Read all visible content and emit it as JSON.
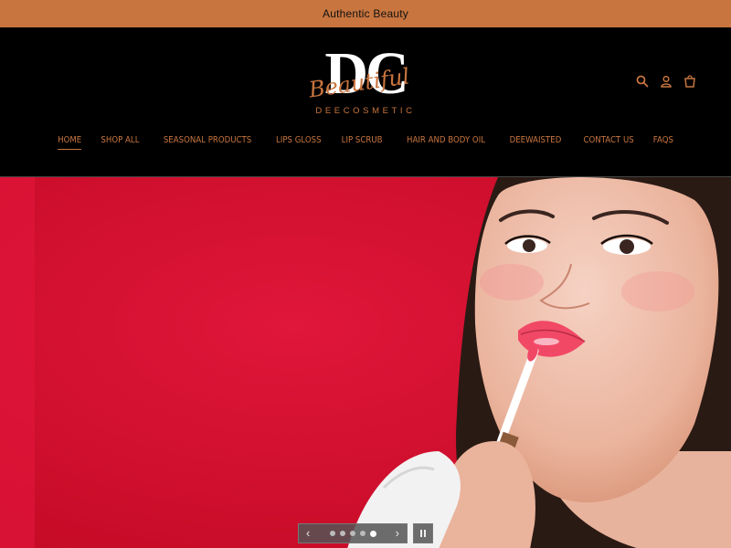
{
  "announcement": {
    "text": "Authentic Beauty"
  },
  "logo": {
    "monogram": "DC",
    "script_text": "Beautiful",
    "brand": "DEECOSMETIC"
  },
  "header_icons": [
    "search-icon",
    "account-icon",
    "cart-icon"
  ],
  "nav": {
    "items": [
      {
        "label": "HOME",
        "active": true
      },
      {
        "label": "SHOP ALL"
      },
      {
        "label": "SEASONAL PRODUCTS"
      },
      {
        "label": "LIPS GLOSS"
      },
      {
        "label": "LIP SCRUB"
      },
      {
        "label": "HAIR AND BODY OIL"
      },
      {
        "label": "DEEWAISTED"
      },
      {
        "label": "CONTACT US"
      },
      {
        "label": "FAQS"
      }
    ]
  },
  "slideshow": {
    "slide_count": 5,
    "active_slide": 5,
    "prev_icon": "chevron-left-icon",
    "next_icon": "chevron-right-icon",
    "pause_icon": "pause-icon"
  },
  "colors": {
    "accent": "#c8753f",
    "header_bg": "#000000",
    "hero_bg": "#d8122e"
  }
}
